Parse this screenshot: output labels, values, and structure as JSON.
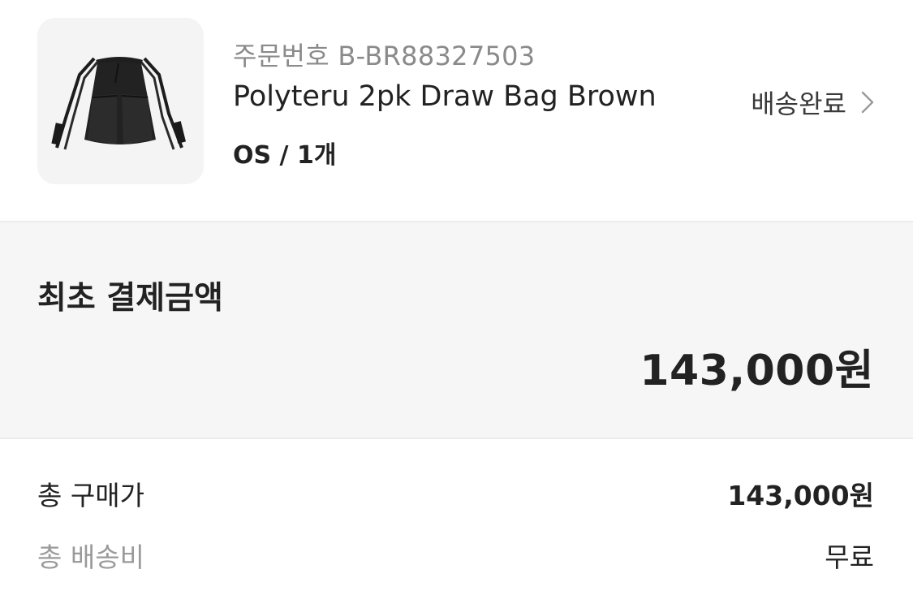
{
  "order": {
    "order_number": "주문번호 B-BR88327503",
    "product_name": "Polyteru 2pk Draw Bag Brown",
    "option": "OS / 1개",
    "status": "배송완료",
    "status_icon": "chevron-right-icon",
    "image_alt": "black drawstring backpack"
  },
  "payment": {
    "title": "최초 결제금액",
    "amount": "143,000원"
  },
  "summary": {
    "rows": [
      {
        "label": "총 구매가",
        "value": "143,000원"
      },
      {
        "label": "총 배송비",
        "value": "무료"
      }
    ]
  },
  "colors": {
    "text_primary": "#222222",
    "text_secondary": "#8a8a8a",
    "payment_background": "#f6f6f6",
    "thumbnail_background": "#f4f4f4"
  }
}
